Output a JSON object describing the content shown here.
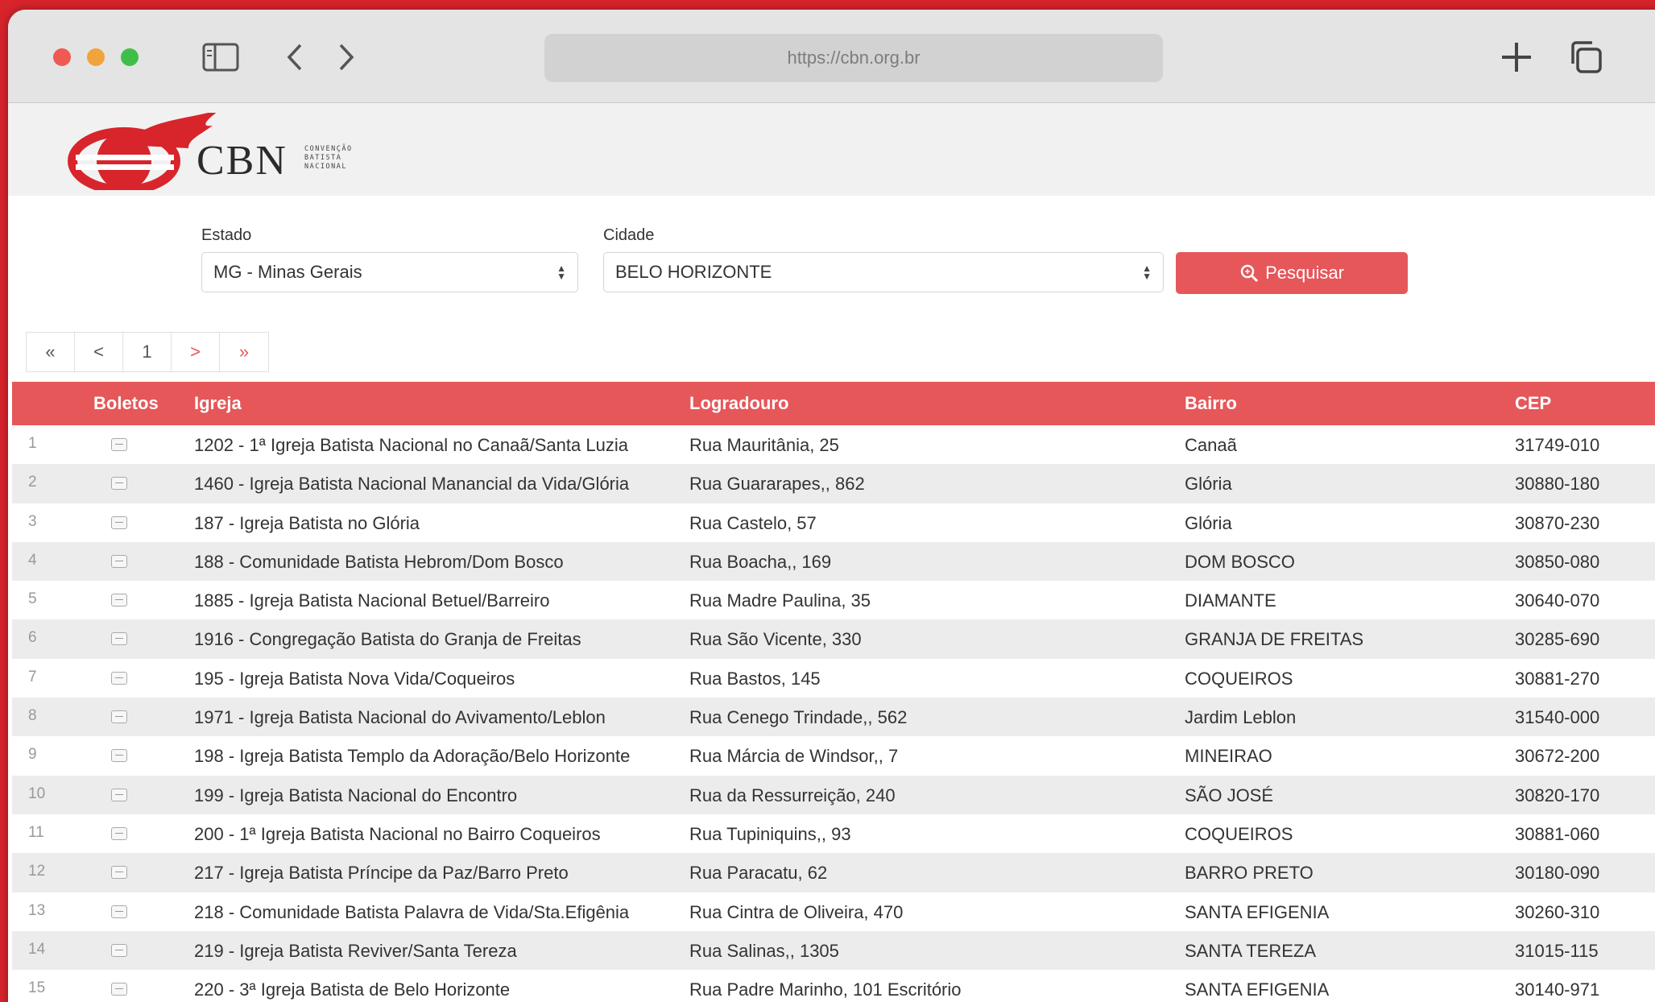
{
  "browser": {
    "url": "https://cbn.org.br"
  },
  "logo": {
    "name": "CBN",
    "tagline": [
      "CONVENÇÃO",
      "BATISTA",
      "NACIONAL"
    ]
  },
  "colors": {
    "brand_red": "#e6575a",
    "background_red": "#d8242b"
  },
  "filters": {
    "estado_label": "Estado",
    "estado_value": "MG - Minas Gerais",
    "cidade_label": "Cidade",
    "cidade_value": "BELO HORIZONTE",
    "search_button": "Pesquisar"
  },
  "pagination": {
    "first": "«",
    "prev": "<",
    "page": "1",
    "next": ">",
    "last": "»"
  },
  "table": {
    "headers": {
      "boletos": "Boletos",
      "igreja": "Igreja",
      "logradouro": "Logradouro",
      "bairro": "Bairro",
      "cep": "CEP"
    },
    "rows": [
      {
        "n": "1",
        "igreja": "1202 - 1ª Igreja Batista Nacional no Canaã/Santa Luzia",
        "logradouro": "Rua Mauritânia, 25",
        "bairro": "Canaã",
        "cep": "31749-010"
      },
      {
        "n": "2",
        "igreja": "1460 - Igreja Batista Nacional Manancial da Vida/Glória",
        "logradouro": "Rua Guararapes,, 862",
        "bairro": "Glória",
        "cep": "30880-180"
      },
      {
        "n": "3",
        "igreja": "187 - Igreja Batista no Glória",
        "logradouro": "Rua Castelo, 57",
        "bairro": "Glória",
        "cep": "30870-230"
      },
      {
        "n": "4",
        "igreja": "188 - Comunidade Batista Hebrom/Dom Bosco",
        "logradouro": "Rua Boacha,, 169",
        "bairro": "DOM BOSCO",
        "cep": "30850-080"
      },
      {
        "n": "5",
        "igreja": "1885 - Igreja Batista Nacional Betuel/Barreiro",
        "logradouro": "Rua Madre Paulina, 35",
        "bairro": "DIAMANTE",
        "cep": "30640-070"
      },
      {
        "n": "6",
        "igreja": "1916 - Congregação Batista do Granja de Freitas",
        "logradouro": "Rua São Vicente, 330",
        "bairro": "GRANJA DE FREITAS",
        "cep": "30285-690"
      },
      {
        "n": "7",
        "igreja": "195 - Igreja Batista Nova Vida/Coqueiros",
        "logradouro": "Rua Bastos, 145",
        "bairro": "COQUEIROS",
        "cep": "30881-270"
      },
      {
        "n": "8",
        "igreja": "1971 - Igreja Batista Nacional do Avivamento/Leblon",
        "logradouro": "Rua Cenego Trindade,, 562",
        "bairro": "Jardim Leblon",
        "cep": "31540-000"
      },
      {
        "n": "9",
        "igreja": "198 - Igreja Batista Templo da Adoração/Belo Horizonte",
        "logradouro": "Rua Márcia de Windsor,, 7",
        "bairro": "MINEIRAO",
        "cep": "30672-200"
      },
      {
        "n": "10",
        "igreja": "199 - Igreja Batista Nacional do Encontro",
        "logradouro": "Rua da Ressurreição, 240",
        "bairro": "SÃO JOSÉ",
        "cep": "30820-170"
      },
      {
        "n": "11",
        "igreja": "200 - 1ª Igreja Batista Nacional no Bairro Coqueiros",
        "logradouro": "Rua Tupiniquins,, 93",
        "bairro": "COQUEIROS",
        "cep": "30881-060"
      },
      {
        "n": "12",
        "igreja": "217 - Igreja Batista Príncipe da Paz/Barro Preto",
        "logradouro": "Rua Paracatu, 62",
        "bairro": "BARRO PRETO",
        "cep": "30180-090"
      },
      {
        "n": "13",
        "igreja": "218 - Comunidade Batista Palavra de Vida/Sta.Efigênia",
        "logradouro": "Rua Cintra de Oliveira, 470",
        "bairro": "SANTA EFIGENIA",
        "cep": "30260-310"
      },
      {
        "n": "14",
        "igreja": "219 - Igreja Batista Reviver/Santa Tereza",
        "logradouro": "Rua Salinas,, 1305",
        "bairro": "SANTA TEREZA",
        "cep": "31015-115"
      },
      {
        "n": "15",
        "igreja": "220 - 3ª Igreja Batista de Belo Horizonte",
        "logradouro": "Rua Padre Marinho, 101 Escritório",
        "bairro": "SANTA EFIGENIA",
        "cep": "30140-971"
      }
    ]
  }
}
